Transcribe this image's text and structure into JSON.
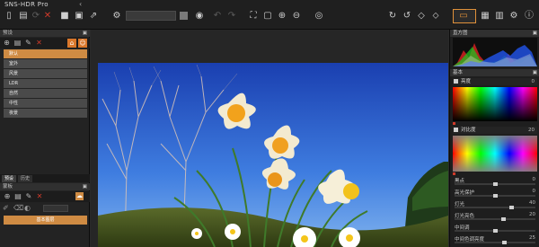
{
  "app": {
    "title": "SNS-HDR Pro",
    "collapse_glyph": "‹"
  },
  "toolbar": {
    "icons": [
      "open-file",
      "open-folder",
      "close",
      "save",
      "save-as",
      "export",
      "settings-gears",
      "record",
      "camera",
      "undo",
      "redo",
      "fit-screen",
      "actual-size",
      "zoom-in",
      "zoom-out",
      "eye",
      "rotate-cw",
      "rotate-ccw",
      "flip-h",
      "flip-v",
      "display",
      "layout",
      "gear",
      "info"
    ]
  },
  "left_panel": {
    "presets_title": "预设",
    "presets": [
      "默认",
      "室外",
      "风景",
      "LDR",
      "自然",
      "中性",
      "夜景"
    ],
    "selected_preset": "默认",
    "tabs": [
      "预设",
      "历史"
    ],
    "active_tab": "预设",
    "mask_title": "蒙板",
    "basic_button": "基本图层"
  },
  "right_panel": {
    "histogram_title": "直方图",
    "basic_title": "基本",
    "brightness": {
      "label": "亮度",
      "value": "0"
    },
    "saturation": {
      "label": "对比度",
      "value": "20"
    },
    "sliders": [
      {
        "label": "黑点",
        "value": "0",
        "pos": 0.5
      },
      {
        "label": "高光保护",
        "value": "0",
        "pos": 0.5
      },
      {
        "label": "灯光",
        "value": "40",
        "pos": 0.7
      },
      {
        "label": "灯光亮色",
        "value": "20",
        "pos": 0.6
      },
      {
        "label": "中间调",
        "value": "",
        "pos": 0.5
      },
      {
        "label": "中间色调亮度",
        "value": "25",
        "pos": 0.62
      }
    ]
  },
  "colors": {
    "accent": "#cf8b43",
    "toolbar_bg": "#1f1f1f",
    "panel_bg": "#232323",
    "red": "#d03a2a"
  }
}
